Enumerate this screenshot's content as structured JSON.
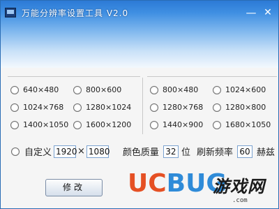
{
  "window": {
    "title": "万能分辨率设置工具 V2.0",
    "min_symbol": "—",
    "close_symbol": "✕"
  },
  "resolutions_left": [
    "640×480",
    "800×600",
    "1024×768",
    "1280×1024",
    "1400×1050",
    "1600×1200"
  ],
  "resolutions_right": [
    "800×480",
    "1024×600",
    "1280×768",
    "1280×800",
    "1440×900",
    "1680×1050"
  ],
  "custom": {
    "label": "自定义",
    "width": "1920",
    "multiply": "×",
    "height": "1080",
    "color_label": "颜色质量",
    "color_value": "32",
    "color_unit": "位",
    "refresh_label": "刷新频率",
    "refresh_value": "60",
    "refresh_unit": "赫兹"
  },
  "modify_button": "修改",
  "watermark": {
    "uc": "UC",
    "bug": "BUG",
    "cn": "游戏网",
    "url": ".com"
  },
  "colors": {
    "title_gradient_top": "#2c7ad6",
    "watermark_uc": "#e55024",
    "watermark_bug": "#2f8bd8"
  }
}
